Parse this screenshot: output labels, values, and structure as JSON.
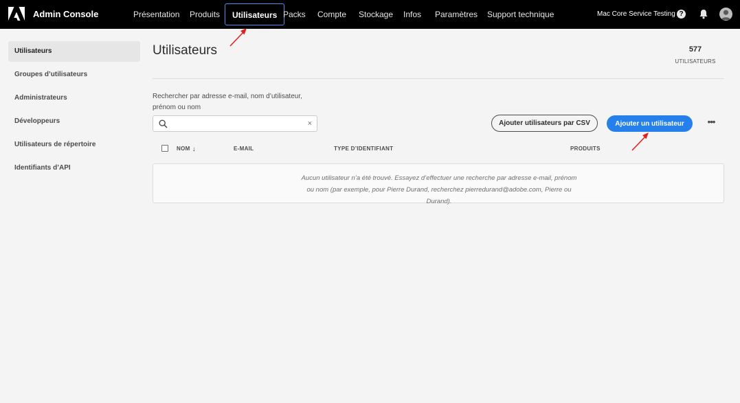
{
  "header": {
    "app_title": "Admin Console",
    "nav": [
      {
        "label": "Présentation"
      },
      {
        "label": "Produits"
      },
      {
        "label": "Utilisateurs",
        "active": true
      },
      {
        "label": "Packs"
      },
      {
        "label": "Compte"
      },
      {
        "label": "Stockage"
      },
      {
        "label": "Infos"
      },
      {
        "label": "Paramètres"
      },
      {
        "label": "Support technique"
      }
    ],
    "account_name": "Mac Core Service Testing",
    "help_glyph": "?",
    "icons": [
      "adobe-logo-icon",
      "help-icon",
      "bell-icon",
      "avatar"
    ]
  },
  "sidebar": {
    "items": [
      {
        "label": "Utilisateurs",
        "active": true
      },
      {
        "label": "Groupes d’utilisateurs"
      },
      {
        "label": "Administrateurs"
      },
      {
        "label": "Développeurs"
      },
      {
        "label": "Utilisateurs de répertoire"
      },
      {
        "label": "Identifiants d’API"
      }
    ]
  },
  "main": {
    "title": "Utilisateurs",
    "count": "577",
    "count_label": "UTILISATEURS",
    "search": {
      "label": "Rechercher par adresse e-mail, nom d’utilisateur, prénom ou nom",
      "value": "",
      "placeholder": "",
      "clear_glyph": "×"
    },
    "buttons": {
      "csv": "Ajouter utilisateurs par CSV",
      "add": "Ajouter un utilisateur",
      "more": "•••"
    },
    "columns": [
      "NOM",
      "E-MAIL",
      "TYPE D’IDENTIFIANT",
      "PRODUITS"
    ],
    "sort_glyph": "↓",
    "empty_message": "Aucun utilisateur n’a été trouvé. Essayez d’effectuer une recherche par adresse e-mail, prénom ou nom (par exemple, pour Pierre Durand, recherchez pierredurand@adobe.com, Pierre ou Durand)."
  },
  "colors": {
    "topbar": "#000000",
    "accent_blue": "#2680eb",
    "active_outline": "#4b8ef0",
    "annotation_red": "#e02020"
  }
}
